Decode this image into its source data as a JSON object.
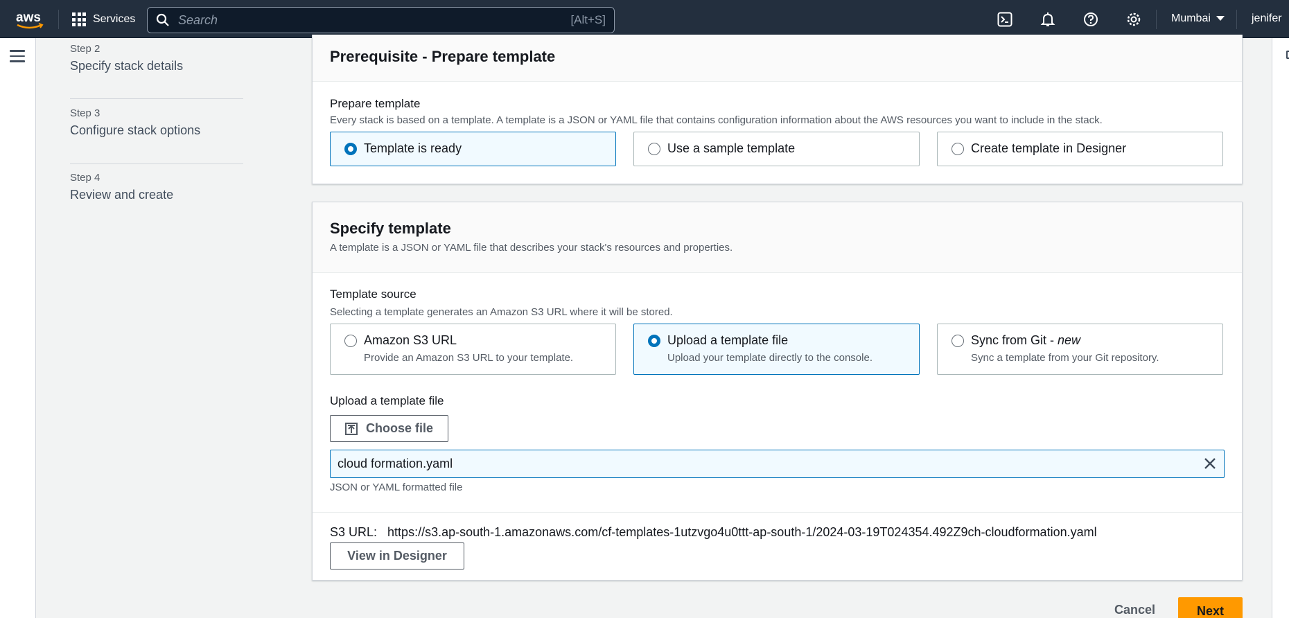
{
  "topnav": {
    "services_label": "Services",
    "search_placeholder": "Search",
    "search_shortcut": "[Alt+S]",
    "region": "Mumbai",
    "user": "jenifer",
    "colors": {
      "bg": "#232f3e",
      "accent": "#ff9900"
    }
  },
  "steps": [
    {
      "num": "Step 2",
      "title": "Specify stack details"
    },
    {
      "num": "Step 3",
      "title": "Configure stack options"
    },
    {
      "num": "Step 4",
      "title": "Review and create"
    }
  ],
  "prerequisite": {
    "title": "Prerequisite - Prepare template",
    "field_label": "Prepare template",
    "field_desc": "Every stack is based on a template. A template is a JSON or YAML file that contains configuration information about the AWS resources you want to include in the stack.",
    "options": [
      {
        "label": "Template is ready",
        "selected": true
      },
      {
        "label": "Use a sample template",
        "selected": false
      },
      {
        "label": "Create template in Designer",
        "selected": false
      }
    ]
  },
  "specify": {
    "title": "Specify template",
    "desc": "A template is a JSON or YAML file that describes your stack's resources and properties.",
    "source_label": "Template source",
    "source_desc": "Selecting a template generates an Amazon S3 URL where it will be stored.",
    "options": [
      {
        "label": "Amazon S3 URL",
        "desc": "Provide an Amazon S3 URL to your template.",
        "selected": false
      },
      {
        "label": "Upload a template file",
        "desc": "Upload your template directly to the console.",
        "selected": true
      },
      {
        "label": "Sync from Git - ",
        "label_em": "new",
        "desc": "Sync a template from your Git repository.",
        "selected": false
      }
    ],
    "upload_label": "Upload a template file",
    "choose_file": "Choose file",
    "file_name": "cloud formation.yaml",
    "file_hint": "JSON or YAML formatted file",
    "s3_label": "S3 URL:",
    "s3_url": "https://s3.ap-south-1.amazonaws.com/cf-templates-1utzvgo4u0ttt-ap-south-1/2024-03-19T024354.492Z9ch-cloudformation.yaml",
    "view_designer": "View in Designer"
  },
  "footer": {
    "cancel": "Cancel",
    "next": "Next"
  }
}
